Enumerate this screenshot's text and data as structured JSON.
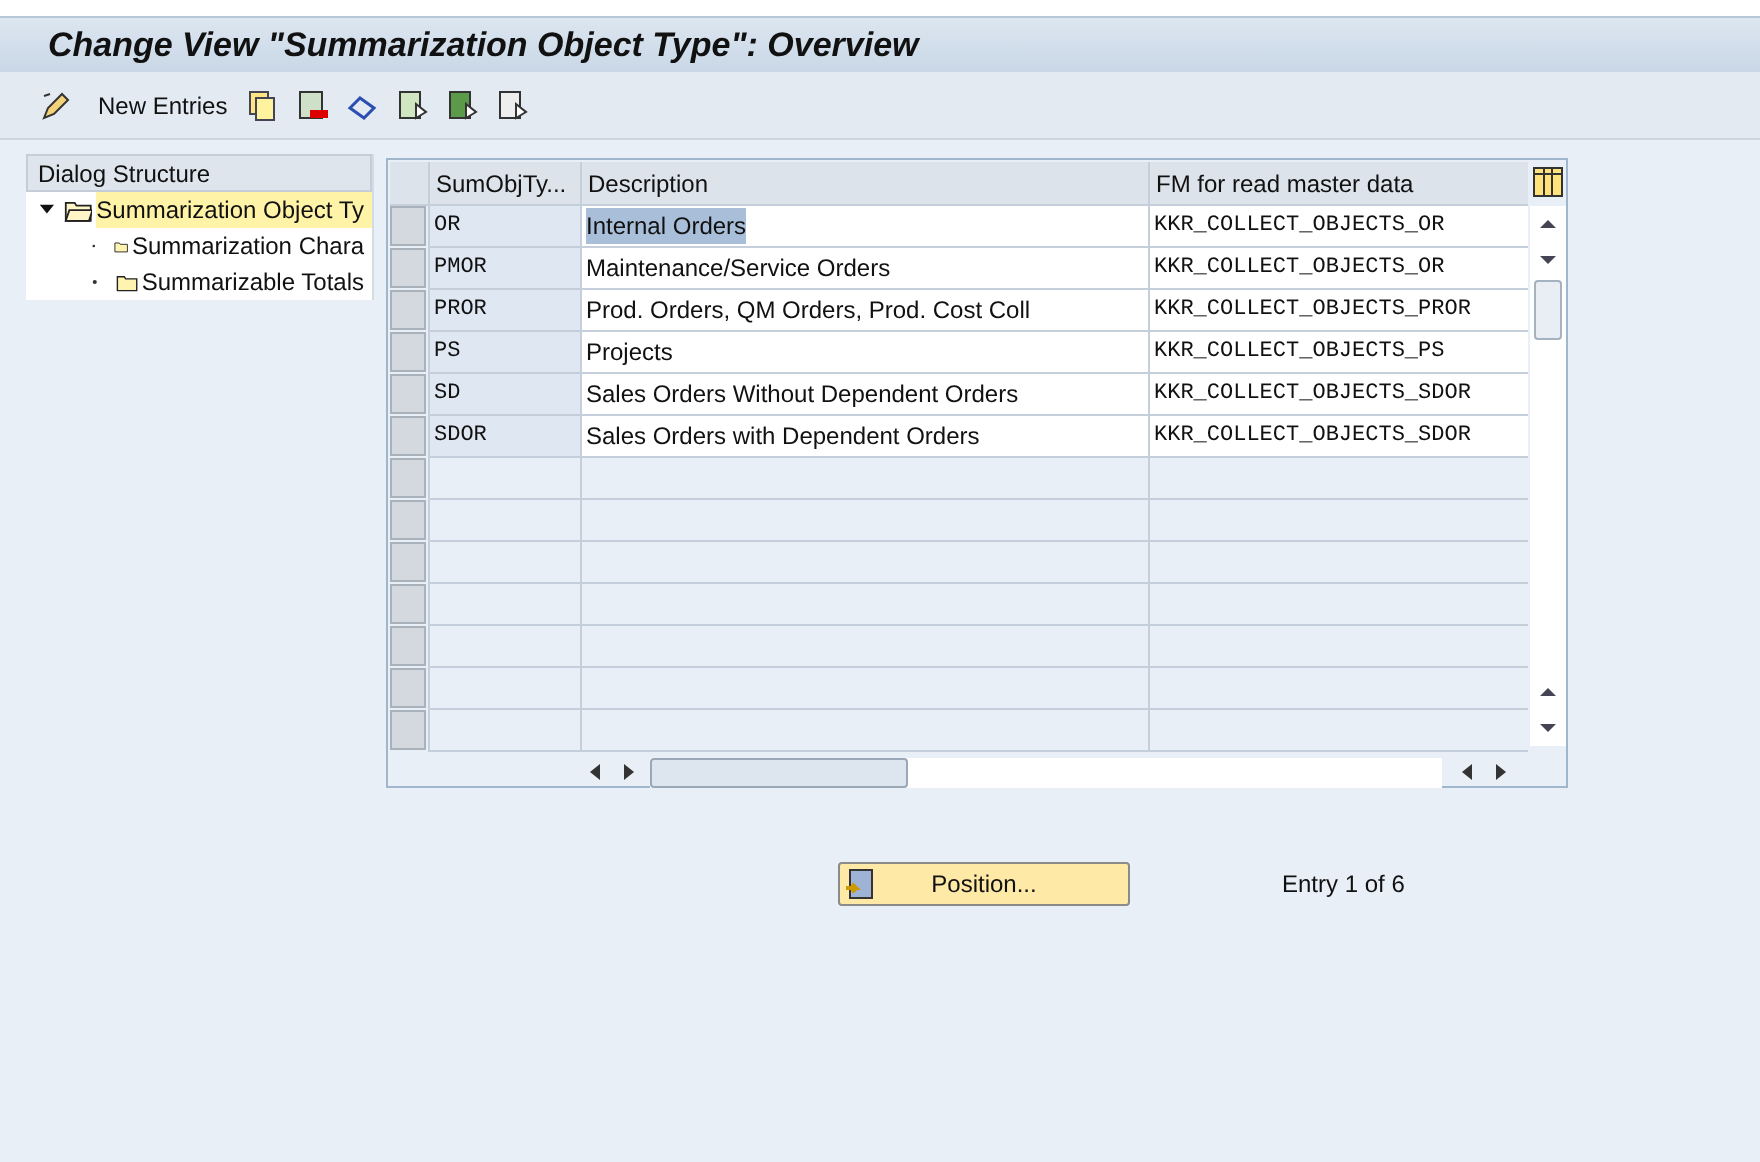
{
  "window": {
    "title": "Change View \"Summarization Object Type\": Overview"
  },
  "toolbar": {
    "new_entries": "New Entries"
  },
  "sidebar": {
    "title": "Dialog Structure",
    "items": [
      {
        "label": "Summarization Object Ty",
        "selected": true,
        "expanded": true,
        "children": [
          {
            "label": "Summarization Chara",
            "selected": false
          },
          {
            "label": "Summarizable Totals",
            "selected": false
          }
        ]
      }
    ]
  },
  "table": {
    "columns": [
      "SumObjTy...",
      "Description",
      "FM for read master data"
    ],
    "rows": [
      {
        "cells": [
          "OR",
          "Internal Orders",
          "KKR_COLLECT_OBJECTS_OR"
        ],
        "selected": true
      },
      {
        "cells": [
          "PMOR",
          "Maintenance/Service Orders",
          "KKR_COLLECT_OBJECTS_OR"
        ],
        "selected": false
      },
      {
        "cells": [
          "PROR",
          "Prod. Orders, QM Orders, Prod. Cost Coll",
          "KKR_COLLECT_OBJECTS_PROR"
        ],
        "selected": false
      },
      {
        "cells": [
          "PS",
          "Projects",
          "KKR_COLLECT_OBJECTS_PS"
        ],
        "selected": false
      },
      {
        "cells": [
          "SD",
          "Sales Orders Without Dependent Orders",
          "KKR_COLLECT_OBJECTS_SDOR"
        ],
        "selected": false
      },
      {
        "cells": [
          "SDOR",
          "Sales Orders with Dependent Orders",
          "KKR_COLLECT_OBJECTS_SDOR"
        ],
        "selected": false
      }
    ]
  },
  "footer": {
    "position_button": "Position...",
    "entry_info": "Entry 1 of 6"
  }
}
